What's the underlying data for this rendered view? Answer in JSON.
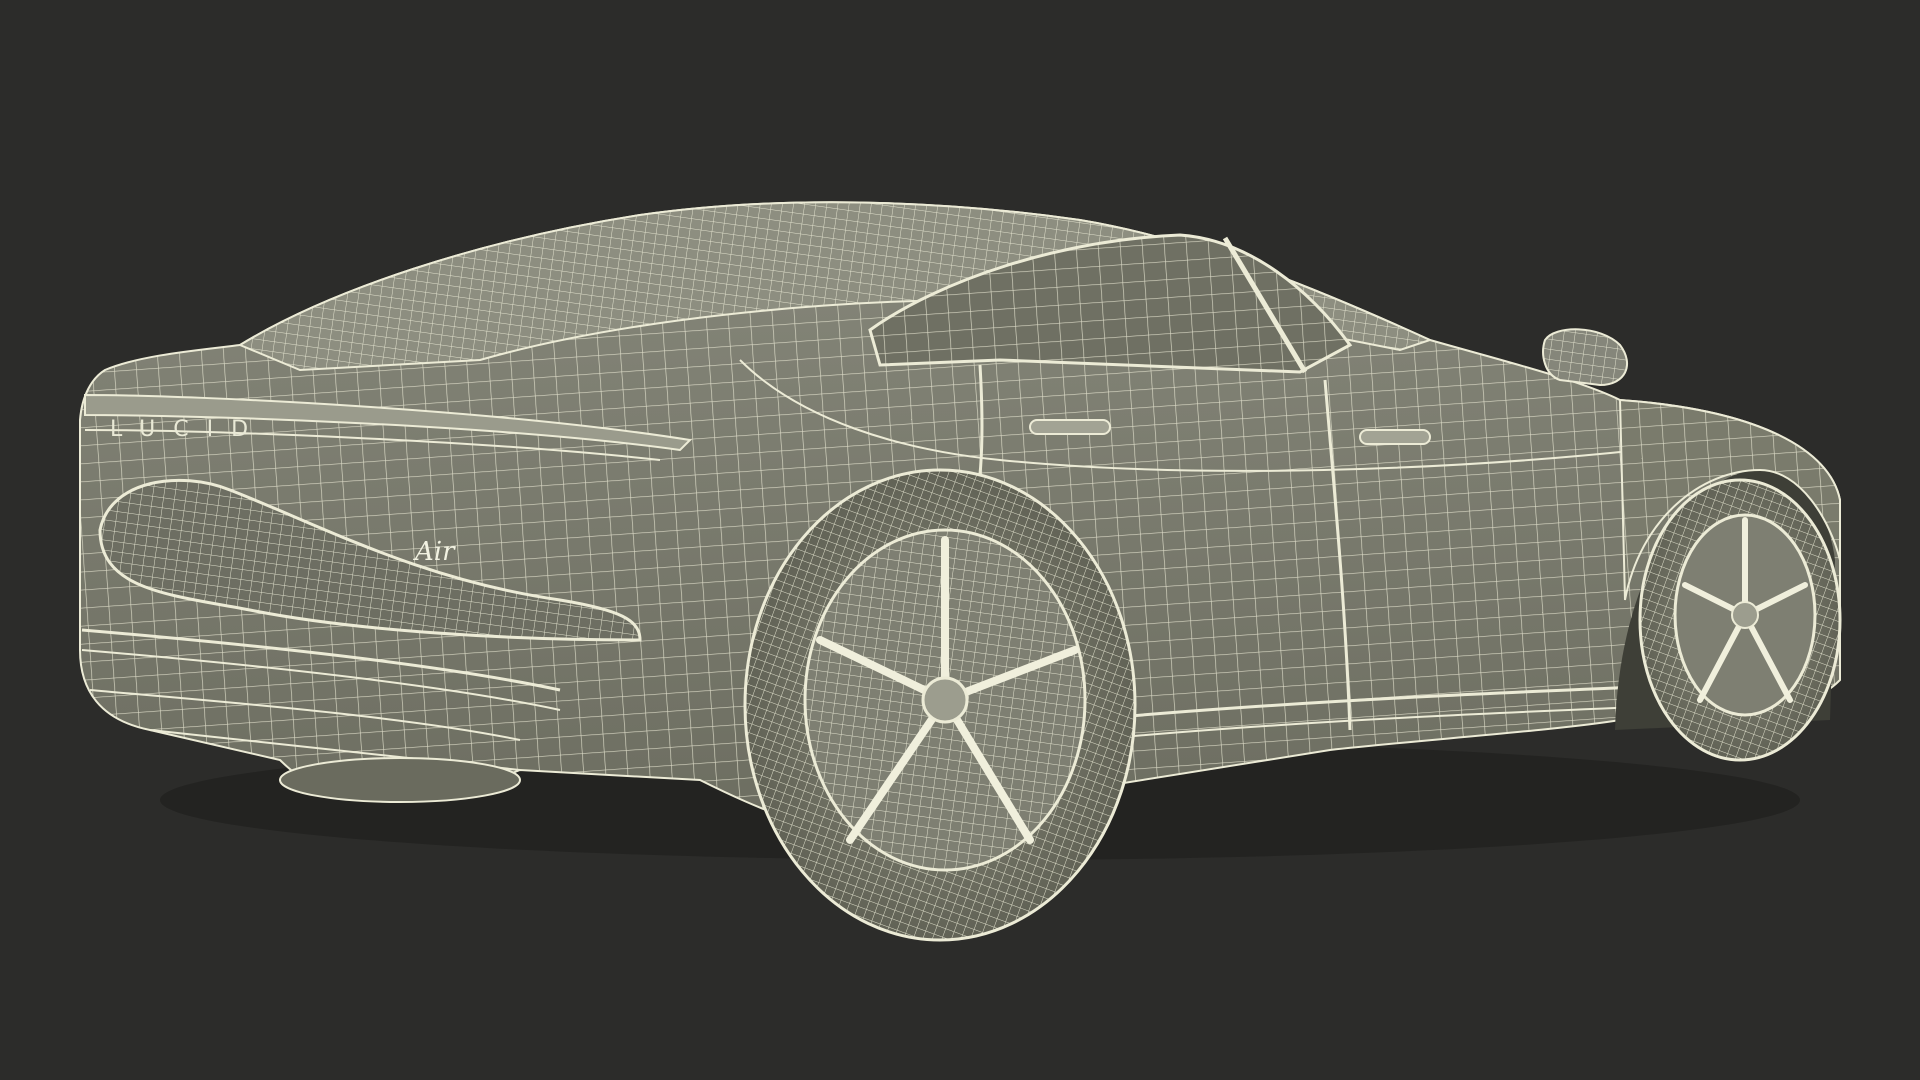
{
  "scene": {
    "background_color": "#2c2c2a",
    "body_color": "#7a7b6c",
    "body_shadow_color": "#5e5f52",
    "wire_color": "#ecebd6",
    "rear_badge_text": "LUCID",
    "model_script_text": "Air"
  }
}
